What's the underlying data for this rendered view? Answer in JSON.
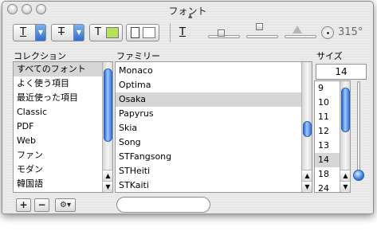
{
  "window": {
    "title": "フォント"
  },
  "toolbar": {
    "underline_glyph": "T",
    "strikethrough_glyph": "T",
    "text_color_glyph": "T",
    "text_color_swatch": "#b6e15c",
    "shadow_glyph": "T",
    "angle_label": "315°"
  },
  "collections": {
    "header": "コレクション",
    "items": [
      "すべてのフォント",
      "よく使う項目",
      "最近使った項目",
      "Classic",
      "PDF",
      "Web",
      "ファン",
      "モダン",
      "韓国語"
    ],
    "selected_index": 0
  },
  "families": {
    "header": "ファミリー",
    "items": [
      "Monaco",
      "Optima",
      "Osaka",
      "Papyrus",
      "Skia",
      "Song",
      "STFangsong",
      "STHeiti",
      "STKaiti"
    ],
    "selected_index": 2
  },
  "sizes": {
    "header": "サイズ",
    "current_value": "14",
    "items": [
      "9",
      "10",
      "11",
      "12",
      "13",
      "14",
      "18",
      "24"
    ],
    "selected_index": 5
  },
  "bottom": {
    "add_label": "+",
    "remove_label": "−",
    "action_label": "⚙▾"
  },
  "search": {
    "value": ""
  },
  "colors": {
    "selection_gray": "#d6d6d6",
    "aqua_blue": "#3a77d8"
  }
}
